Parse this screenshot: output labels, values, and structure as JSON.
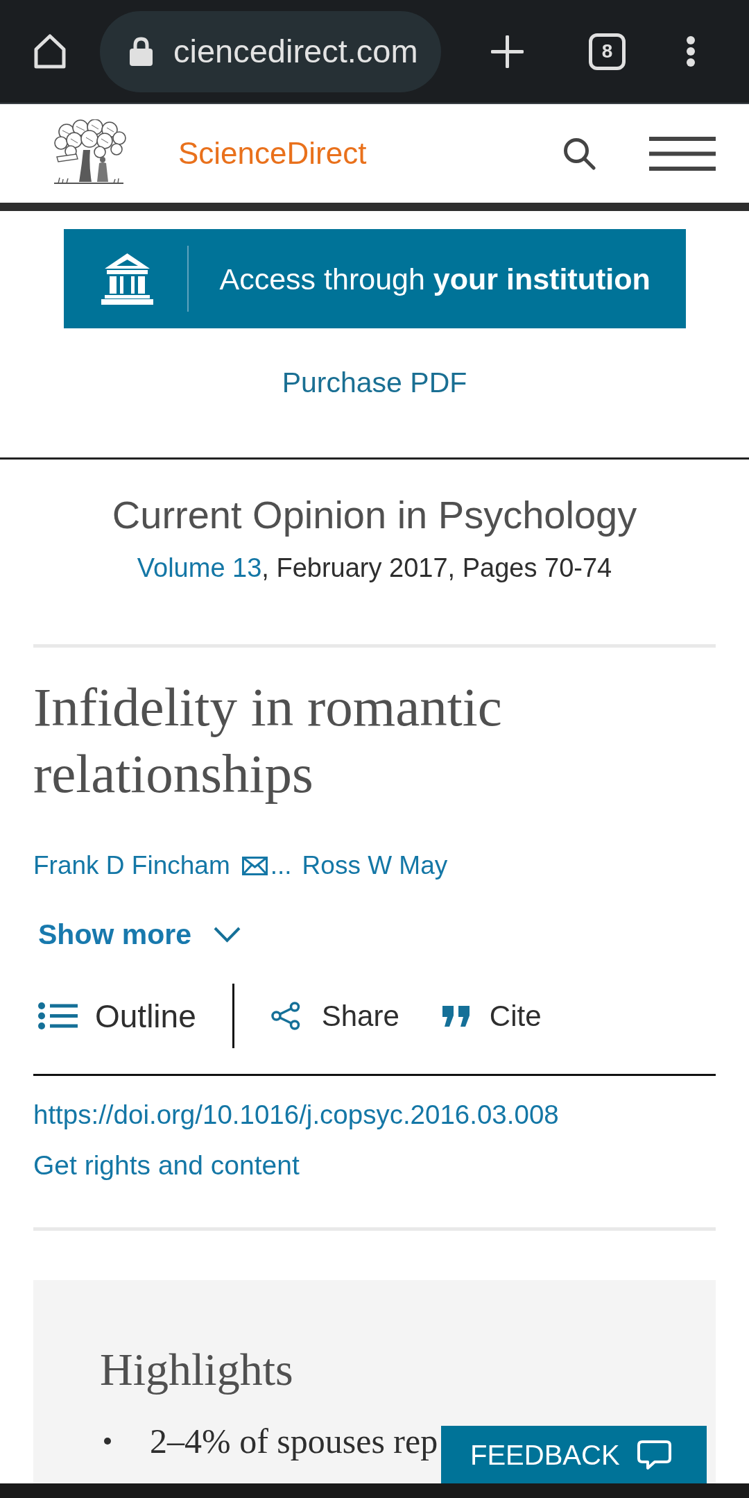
{
  "browser_bar": {
    "url": "ciencedirect.com",
    "tab_count": "8"
  },
  "site_header": {
    "brand": "ScienceDirect"
  },
  "access": {
    "institution_button": "Access through **your institution**",
    "purchase_link": "Purchase PDF"
  },
  "journal": {
    "name": "Current Opinion in Psychology",
    "volume_link": "Volume 13",
    "issue_details": ", February 2017, Pages 70-74"
  },
  "article": {
    "title": "Infidelity in romantic relationships",
    "authors": [
      {
        "name": "Frank D Fincham",
        "email": true
      },
      {
        "name": "Ross W May",
        "email": false
      }
    ],
    "authors_ellipsis": "...",
    "show_more": {
      "label": "Show more",
      "expanded": false
    }
  },
  "actions": [
    {
      "kind": "outline",
      "label": "Outline"
    },
    {
      "kind": "share",
      "label": "Share"
    },
    {
      "kind": "cite",
      "label": "Cite"
    }
  ],
  "doi_link": "https://doi.org/10.1016/j.copsyc.2016.03.008",
  "rights_link": "Get rights and content",
  "highlights": {
    "heading": "Highlights",
    "items": [
      "2–4% of spouses rep"
    ]
  },
  "feedback_button": {
    "label": "FEEDBACK"
  }
}
